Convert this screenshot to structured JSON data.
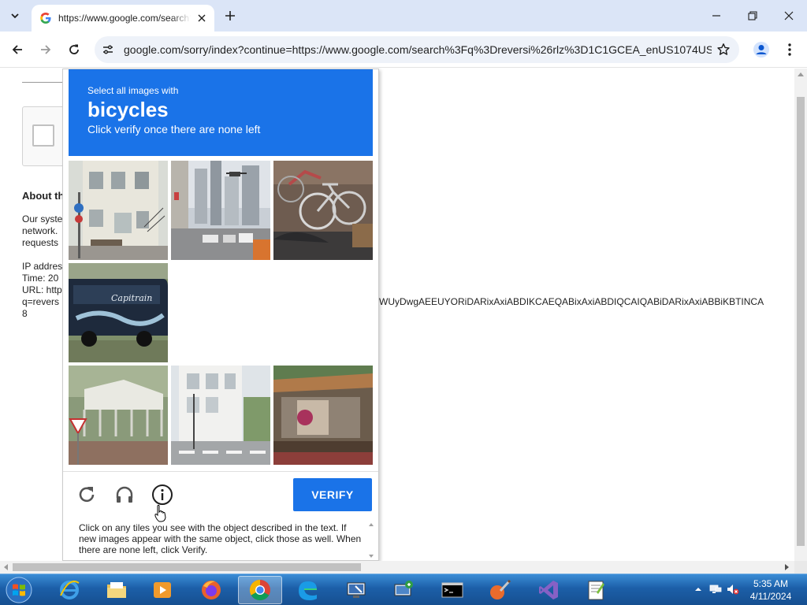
{
  "tab": {
    "title": "https://www.google.com/search?q=reversi"
  },
  "omnibox": {
    "url": "google.com/sorry/index?continue=https://www.google.com/search%3Fq%3Dreversi%26rlz%3D1C1GCEA_enUS1074US..."
  },
  "background_page": {
    "heading": "About th",
    "text_lines": [
      "Our syste",
      "network.",
      "requests",
      "IP addres",
      "Time: 20",
      "URL: http",
      "q=revers",
      "8"
    ],
    "url_tail": "WUyDwgAEEUYORiDARixAxiABDIKCAEQABixAxiABDIQCAIQABiDARixAxiABBiKBTINCA"
  },
  "captcha": {
    "instruction_line1": "Select all images with",
    "target_object": "bicycles",
    "instruction_line3": "Click verify once there are none left",
    "verify_label": "VERIFY",
    "help_text": "Click on any tiles you see with the object described in the text. If new images appear with the same object, click those as well. When there are none left, click Verify.",
    "tiles": [
      {
        "index": 1,
        "state": "image"
      },
      {
        "index": 2,
        "state": "image"
      },
      {
        "index": 3,
        "state": "image"
      },
      {
        "index": 4,
        "state": "image"
      },
      {
        "index": 5,
        "state": "loading"
      },
      {
        "index": 6,
        "state": "loading"
      },
      {
        "index": 7,
        "state": "image"
      },
      {
        "index": 8,
        "state": "image"
      },
      {
        "index": 9,
        "state": "image"
      }
    ]
  },
  "taskbar": {
    "apps": [
      {
        "name": "internet-explorer"
      },
      {
        "name": "file-explorer"
      },
      {
        "name": "media-player"
      },
      {
        "name": "firefox"
      },
      {
        "name": "chrome",
        "active": true
      },
      {
        "name": "edge"
      },
      {
        "name": "remote-desktop"
      },
      {
        "name": "network-tool"
      },
      {
        "name": "command-prompt"
      },
      {
        "name": "paint"
      },
      {
        "name": "visual-studio"
      },
      {
        "name": "notepad-plus-plus"
      }
    ],
    "clock_time": "5:35 AM",
    "clock_date": "4/11/2024"
  },
  "colors": {
    "captcha_blue": "#1a73e8",
    "taskbar_blue": "#1c5fa8",
    "chrome_frame": "#dbe5f7"
  }
}
